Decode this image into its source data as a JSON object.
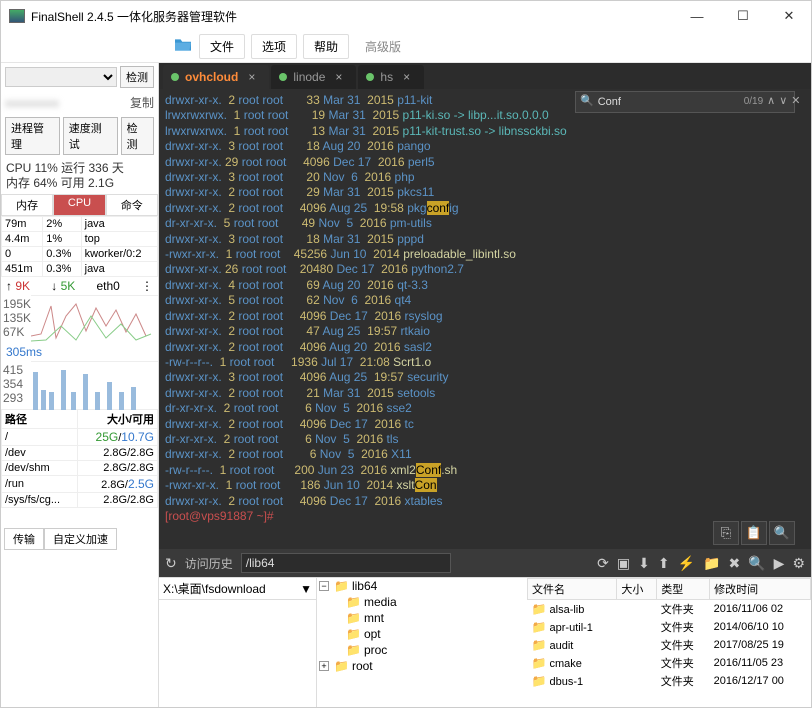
{
  "window": {
    "title": "FinalShell 2.4.5 一体化服务器管理软件"
  },
  "menu": {
    "file": "文件",
    "options": "选项",
    "help": "帮助",
    "pro": "高级版"
  },
  "left": {
    "detect": "检测",
    "copy": "复制",
    "procmgr": "进程管理",
    "speed": "速度测试",
    "cpu": "CPU 11% 运行 336 天",
    "mem": "内存 64% 可用 2.1G",
    "hdr_mem": "内存",
    "hdr_cpu": "CPU",
    "hdr_cmd": "命令",
    "procs": [
      [
        "79m",
        "2%",
        "java"
      ],
      [
        "4.4m",
        "1%",
        "top"
      ],
      [
        "0",
        "0.3%",
        "kworker/0:2"
      ],
      [
        "451m",
        "0.3%",
        "java"
      ]
    ],
    "net_up": "9K",
    "net_dn": "5K",
    "net_if": "eth0",
    "y1": "195K",
    "y2": "135K",
    "y3": "67K",
    "ping": "305ms",
    "p1": "415",
    "p2": "354",
    "p3": "293",
    "disk_h1": "路径",
    "disk_h2": "大小/可用",
    "disks": [
      [
        "/",
        "25G/10.7G"
      ],
      [
        "/dev",
        "2.8G/2.8G"
      ],
      [
        "/dev/shm",
        "2.8G/2.8G"
      ],
      [
        "/run",
        "2.8G/2.5G"
      ],
      [
        "/sys/fs/cg...",
        "2.8G/2.8G"
      ]
    ],
    "transfer": "传输",
    "custom": "自定义加速",
    "local": "X:\\桌面\\fsdownload"
  },
  "tabs": [
    {
      "label": "ovhcloud",
      "active": true
    },
    {
      "label": "linode"
    },
    {
      "label": "hs"
    }
  ],
  "search": {
    "value": "Conf",
    "count": "0/19"
  },
  "term": {
    "rows": [
      {
        "perm": "drwxr-xr-x.",
        "n": "2",
        "o": "root root",
        "s": "33",
        "d": "Mar 31",
        "y": "2015",
        "name": "p11-kit",
        "cls": "dir"
      },
      {
        "perm": "lrwxrwxrwx.",
        "n": "1",
        "o": "root root",
        "s": "19",
        "d": "Mar 31",
        "y": "2015",
        "name": "p11-ki",
        "cls": "link",
        "suffix": ".so -> libp...it.so.0.0.0"
      },
      {
        "perm": "lrwxrwxrwx.",
        "n": "1",
        "o": "root root",
        "s": "13",
        "d": "Mar 31",
        "y": "2015",
        "name": "p11-kit-trust.so -> libnssckbi.so",
        "cls": "link"
      },
      {
        "perm": "drwxr-xr-x.",
        "n": "3",
        "o": "root root",
        "s": "18",
        "d": "Aug 20",
        "y": "2016",
        "name": "pango",
        "cls": "dir"
      },
      {
        "perm": "drwxr-xr-x.",
        "n": "29",
        "o": "root root",
        "s": "4096",
        "d": "Dec 17",
        "y": "2016",
        "name": "perl5",
        "cls": "dir"
      },
      {
        "perm": "drwxr-xr-x.",
        "n": "3",
        "o": "root root",
        "s": "20",
        "d": "Nov  6",
        "y": "2016",
        "name": "php",
        "cls": "dir"
      },
      {
        "perm": "drwxr-xr-x.",
        "n": "2",
        "o": "root root",
        "s": "29",
        "d": "Mar 31",
        "y": "2015",
        "name": "pkcs11",
        "cls": "dir"
      },
      {
        "perm": "drwxr-xr-x.",
        "n": "2",
        "o": "root root",
        "s": "4096",
        "d": "Aug 25",
        "y": "19:58",
        "name": "pkg",
        "cls": "dir",
        "hl": "conf",
        "after": "ig"
      },
      {
        "perm": "dr-xr-xr-x.",
        "n": "5",
        "o": "root root",
        "s": "49",
        "d": "Nov  5",
        "y": "2016",
        "name": "pm-utils",
        "cls": "dir"
      },
      {
        "perm": "drwxr-xr-x.",
        "n": "3",
        "o": "root root",
        "s": "18",
        "d": "Mar 31",
        "y": "2015",
        "name": "pppd",
        "cls": "dir"
      },
      {
        "perm": "-rwxr-xr-x.",
        "n": "1",
        "o": "root root",
        "s": "45256",
        "d": "Jun 10",
        "y": "2014",
        "name": "preloadable_libintl.so",
        "cls": "file"
      },
      {
        "perm": "drwxr-xr-x.",
        "n": "26",
        "o": "root root",
        "s": "20480",
        "d": "Dec 17",
        "y": "2016",
        "name": "python2.7",
        "cls": "dir"
      },
      {
        "perm": "drwxr-xr-x.",
        "n": "4",
        "o": "root root",
        "s": "69",
        "d": "Aug 20",
        "y": "2016",
        "name": "qt-3.3",
        "cls": "dir"
      },
      {
        "perm": "drwxr-xr-x.",
        "n": "5",
        "o": "root root",
        "s": "62",
        "d": "Nov  6",
        "y": "2016",
        "name": "qt4",
        "cls": "dir"
      },
      {
        "perm": "drwxr-xr-x.",
        "n": "2",
        "o": "root root",
        "s": "4096",
        "d": "Dec 17",
        "y": "2016",
        "name": "rsyslog",
        "cls": "dir"
      },
      {
        "perm": "drwxr-xr-x.",
        "n": "2",
        "o": "root root",
        "s": "47",
        "d": "Aug 25",
        "y": "19:57",
        "name": "rtkaio",
        "cls": "dir"
      },
      {
        "perm": "drwxr-xr-x.",
        "n": "2",
        "o": "root root",
        "s": "4096",
        "d": "Aug 20",
        "y": "2016",
        "name": "sasl2",
        "cls": "dir"
      },
      {
        "perm": "-rw-r--r--.",
        "n": "1",
        "o": "root root",
        "s": "1936",
        "d": "Jul 17",
        "y": "21:08",
        "name": "Scrt1.o",
        "cls": "file"
      },
      {
        "perm": "drwxr-xr-x.",
        "n": "3",
        "o": "root root",
        "s": "4096",
        "d": "Aug 25",
        "y": "19:57",
        "name": "security",
        "cls": "dir"
      },
      {
        "perm": "drwxr-xr-x.",
        "n": "2",
        "o": "root root",
        "s": "21",
        "d": "Mar 31",
        "y": "2015",
        "name": "setools",
        "cls": "dir"
      },
      {
        "perm": "dr-xr-xr-x.",
        "n": "2",
        "o": "root root",
        "s": "6",
        "d": "Nov  5",
        "y": "2016",
        "name": "sse2",
        "cls": "dir"
      },
      {
        "perm": "drwxr-xr-x.",
        "n": "2",
        "o": "root root",
        "s": "4096",
        "d": "Dec 17",
        "y": "2016",
        "name": "tc",
        "cls": "dir"
      },
      {
        "perm": "dr-xr-xr-x.",
        "n": "2",
        "o": "root root",
        "s": "6",
        "d": "Nov  5",
        "y": "2016",
        "name": "tls",
        "cls": "dir"
      },
      {
        "perm": "drwxr-xr-x.",
        "n": "2",
        "o": "root root",
        "s": "6",
        "d": "Nov  5",
        "y": "2016",
        "name": "X11",
        "cls": "dir"
      },
      {
        "perm": "-rw-r--r--.",
        "n": "1",
        "o": "root root",
        "s": "200",
        "d": "Jun 23",
        "y": "2016",
        "name": "xml2",
        "cls": "file",
        "hl": "Conf",
        "after": ".sh"
      },
      {
        "perm": "-rwxr-xr-x.",
        "n": "1",
        "o": "root root",
        "s": "186",
        "d": "Jun 10",
        "y": "2014",
        "name": "xslt",
        "cls": "file",
        "hl": "Con"
      },
      {
        "perm": "drwxr-xr-x.",
        "n": "2",
        "o": "root root",
        "s": "4096",
        "d": "Dec 17",
        "y": "2016",
        "name": "xtables",
        "cls": "dir"
      }
    ],
    "prompt": "[root@vps91887 ~]#"
  },
  "status": {
    "history": "访问历史",
    "path": "/lib64"
  },
  "tree": {
    "items": [
      "lib64",
      "media",
      "mnt",
      "opt",
      "proc",
      "root"
    ]
  },
  "filelist": {
    "hdr": [
      "文件名",
      "大小",
      "类型",
      "修改时间"
    ],
    "rows": [
      [
        "alsa-lib",
        "",
        "文件夹",
        "2016/11/06 02"
      ],
      [
        "apr-util-1",
        "",
        "文件夹",
        "2014/06/10 10"
      ],
      [
        "audit",
        "",
        "文件夹",
        "2017/08/25 19"
      ],
      [
        "cmake",
        "",
        "文件夹",
        "2016/11/05 23"
      ],
      [
        "dbus-1",
        "",
        "文件夹",
        "2016/12/17 00"
      ]
    ]
  }
}
